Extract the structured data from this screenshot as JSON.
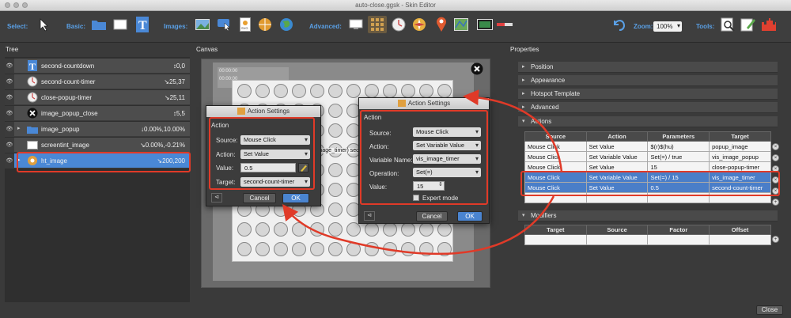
{
  "window": {
    "title": "auto-close.ggsk - Skin Editor"
  },
  "toolbar": {
    "select_label": "Select:",
    "basic_label": "Basic:",
    "images_label": "Images:",
    "advanced_label": "Advanced:",
    "zoom_label": "Zoom:",
    "zoom_value": "100%",
    "tools_label": "Tools:"
  },
  "tree": {
    "title": "Tree",
    "items": [
      {
        "name": "second-countdown",
        "value": "↕0,0",
        "icon": "text-icon"
      },
      {
        "name": "second-count-timer",
        "value": "↘25,37",
        "icon": "timer-icon"
      },
      {
        "name": "close-popup-timer",
        "value": "↘25,11",
        "icon": "timer-icon"
      },
      {
        "name": "image_popup_close",
        "value": "↕5,5",
        "icon": "close-icon"
      },
      {
        "name": "image_popup",
        "value": "↓0.00%,10.00%",
        "icon": "folder-icon"
      },
      {
        "name": "screentint_image",
        "value": "↘0.00%,-0.21%",
        "icon": "rect-icon"
      },
      {
        "name": "ht_image",
        "value": "↘200,200",
        "icon": "hotspot-icon"
      }
    ]
  },
  "canvas": {
    "title": "Canvas",
    "countdown_text": "00:00:00",
    "timer_text": "00:00:00",
    "label_text": "image_timer) second"
  },
  "dialog_left": {
    "title": "Action Settings",
    "section": "Action",
    "source_label": "Source:",
    "source_value": "Mouse Click",
    "action_label": "Action:",
    "action_value": "Set Value",
    "value_label": "Value:",
    "value_value": "0.5",
    "target_label": "Target:",
    "target_value": "second-count-timer",
    "cancel": "Cancel",
    "ok": "OK"
  },
  "dialog_right": {
    "title": "Action Settings",
    "section": "Action",
    "source_label": "Source:",
    "source_value": "Mouse Click",
    "action_label": "Action:",
    "action_value": "Set Variable Value",
    "varname_label": "Variable Name:",
    "varname_value": "vis_image_timer",
    "operation_label": "Operation:",
    "operation_value": "Set(=)",
    "value_label": "Value:",
    "value_value": "15",
    "expert_label": "Expert mode",
    "cancel": "Cancel",
    "ok": "OK"
  },
  "properties": {
    "title": "Properties",
    "sections": [
      "Position",
      "Appearance",
      "Hotspot Template",
      "Advanced",
      "Actions"
    ],
    "actions_table": {
      "headers": [
        "Source",
        "Action",
        "Parameters",
        "Target"
      ],
      "rows": [
        [
          "Mouse Click",
          "Set Value",
          "$(r)$(hu)",
          "popup_image"
        ],
        [
          "Mouse Click",
          "Set Variable Value",
          "Set(=) / true",
          "vis_image_popup"
        ],
        [
          "Mouse Click",
          "Set Value",
          "15",
          "close-popup-timer"
        ],
        [
          "Mouse Click",
          "Set Variable Value",
          "Set(=) / 15",
          "vis_image_timer"
        ],
        [
          "Mouse Click",
          "Set Value",
          "0.5",
          "second-count-timer"
        ]
      ]
    },
    "modifiers_title": "Modifiers",
    "modifiers_table": {
      "headers": [
        "Target",
        "Source",
        "Factor",
        "Offset"
      ]
    }
  },
  "footer": {
    "close": "Close"
  },
  "colors": {
    "accent": "#4a88d6",
    "highlight": "#e03a28",
    "label_blue": "#5aa0e6"
  }
}
